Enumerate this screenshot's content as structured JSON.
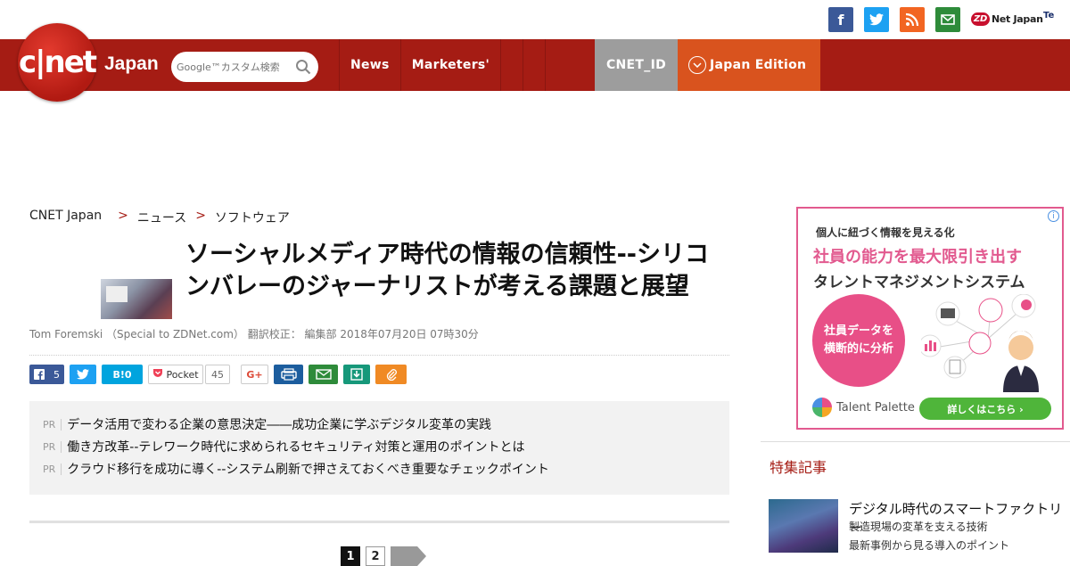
{
  "social": {
    "facebook_glyph": "f",
    "twitter_glyph": "t",
    "rss_glyph": ")",
    "mail_glyph": "✉",
    "zdnet_mark": "ZD",
    "zdnet_text": "Net Japan",
    "techrepublic_text": "Te"
  },
  "header": {
    "logo_text": "c|net",
    "logo_japan": "Japan",
    "search_placeholder": "Google™カスタム検索",
    "nav": [
      "News",
      "Marketers'"
    ],
    "cnet_id": "CNET_ID",
    "japan_edition": "Japan Edition"
  },
  "breadcrumb": {
    "home": "CNET Japan",
    "sep": ">",
    "level1": "ニュース",
    "level2": "ソフトウェア"
  },
  "article": {
    "title": "ソーシャルメディア時代の情報の信頼性--シリコンバレーのジャーナリストが考える課題と展望",
    "byline": "Tom Foremski （Special to ZDNet.com） 翻訳校正： 編集部 2018年07月20日 07時30分"
  },
  "share": {
    "fb_count": "5",
    "hatena_label": "B!0",
    "pocket_label": "Pocket",
    "pocket_count": "45",
    "gplus_label": "G+"
  },
  "pr": {
    "tag": "PR",
    "items": [
      "データ活用で変わる企業の意思決定――成功企業に学ぶデジタル変革の実践",
      "働き方改革--テレワーク時代に求められるセキュリティ対策と運用のポイントとは",
      "クラウド移行を成功に導く--システム刷新で押さえておくべき重要なチェックポイント"
    ]
  },
  "pagination": {
    "p1": "1",
    "p2": "2"
  },
  "ad": {
    "info": "i",
    "line1": "個人に紐づく情報を見える化",
    "line2": "社員の能力を最大限引き出す",
    "line3": "タレントマネジメントシステム",
    "circle": "社員データを横断的に分析",
    "brand": "Talent Palette",
    "cta": "詳しくはこちら ›"
  },
  "sidebar": {
    "heading": "特集記事",
    "item_title": "デジタル時代のスマートファクトリー",
    "item_line2": "製造現場の変革を支える技術",
    "item_line3": "最新事例から見る導入のポイント"
  },
  "colors": {
    "header_red": "#a51c14",
    "cnet_id_gray": "#9d9d9d",
    "japan_edition_orange": "#d9531e",
    "ad_pink": "#e25a8f"
  }
}
